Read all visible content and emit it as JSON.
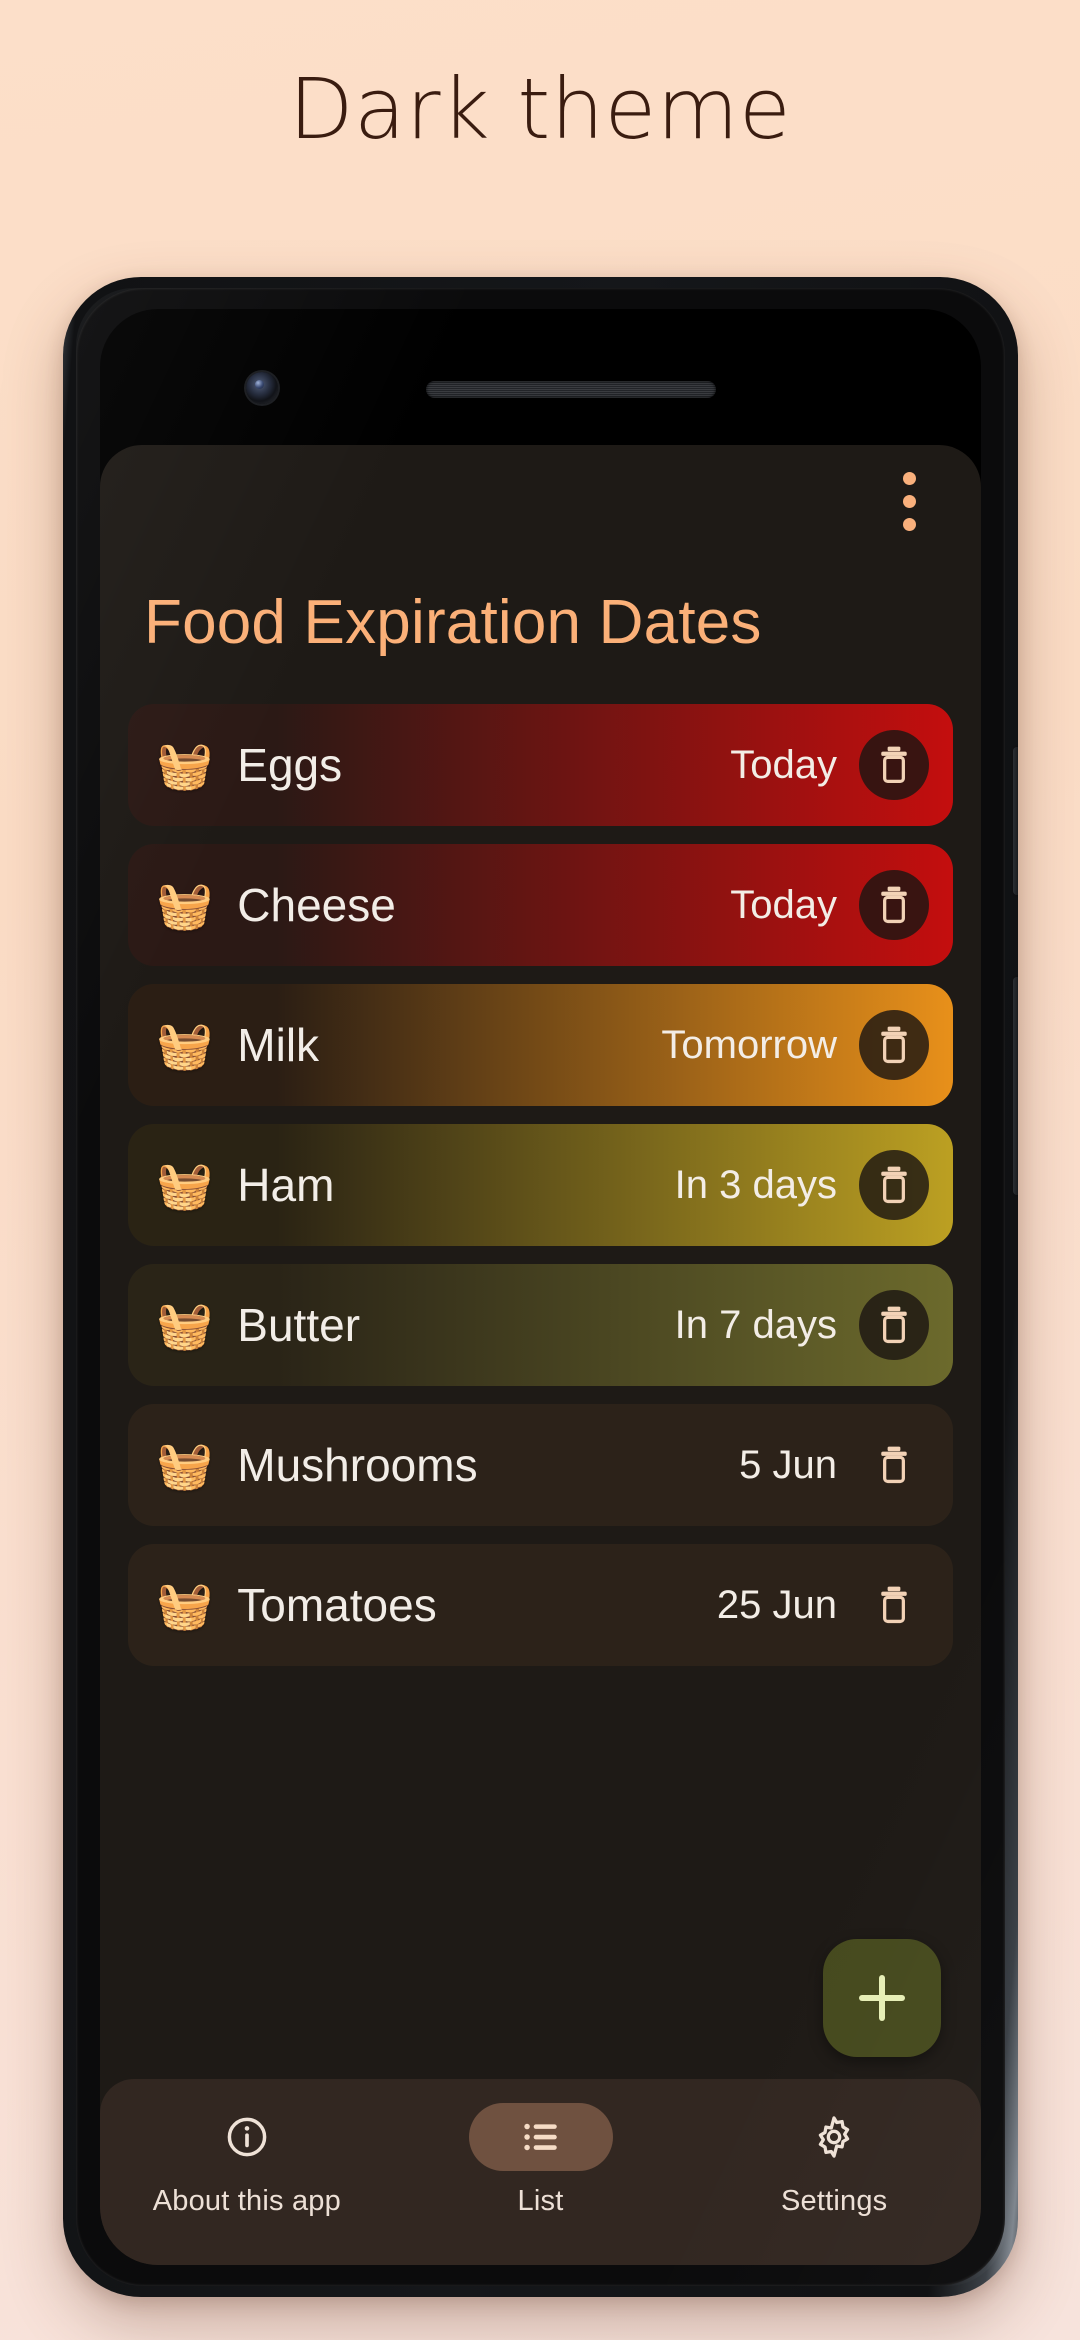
{
  "page": {
    "heading": "Dark theme",
    "background_color": "#FBDEC8",
    "heading_color": "#3A1C10"
  },
  "app": {
    "title": "Food Expiration Dates",
    "title_color": "#FBB078",
    "surface_color": "#1E1A16",
    "overflow_menu_label": "More options",
    "fab": {
      "label": "+",
      "name": "add-item",
      "background_color": "#464A1E",
      "icon_color": "#E6EEB6"
    }
  },
  "list": {
    "item_emoji": "🧺",
    "items": [
      {
        "name": "Eggs",
        "date": "Today",
        "gradient_from": "#2B1915",
        "gradient_to": "#C40E0E",
        "delete_button_shaded": true
      },
      {
        "name": "Cheese",
        "date": "Today",
        "gradient_from": "#2B1915",
        "gradient_to": "#C40E0E",
        "delete_button_shaded": true
      },
      {
        "name": "Milk",
        "date": "Tomorrow",
        "gradient_from": "#2B1E14",
        "gradient_to": "#E8901A",
        "delete_button_shaded": true
      },
      {
        "name": "Ham",
        "date": "In 3 days",
        "gradient_from": "#2A2314",
        "gradient_to": "#BCA022",
        "delete_button_shaded": true
      },
      {
        "name": "Butter",
        "date": "In 7 days",
        "gradient_from": "#2A2417",
        "gradient_to": "#6C6A2C",
        "delete_button_shaded": true
      },
      {
        "name": "Mushrooms",
        "date": "5 Jun",
        "gradient_from": "#2C2219",
        "gradient_to": "#2C2219",
        "delete_button_shaded": false
      },
      {
        "name": "Tomatoes",
        "date": "25 Jun",
        "gradient_from": "#2C2219",
        "gradient_to": "#2C2219",
        "delete_button_shaded": false
      }
    ]
  },
  "bottom_nav": {
    "background_color": "#322721",
    "active_pill_color": "#6F5140",
    "items": [
      {
        "label": "About this app",
        "icon": "info-icon",
        "active": false
      },
      {
        "label": "List",
        "icon": "list-icon",
        "active": true
      },
      {
        "label": "Settings",
        "icon": "gear-icon",
        "active": false
      }
    ]
  }
}
